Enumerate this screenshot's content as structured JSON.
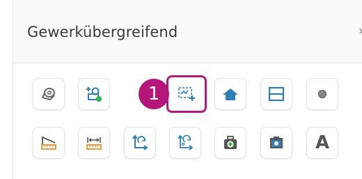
{
  "panel": {
    "title": "Gewerkübergreifend",
    "callout_number": "1"
  },
  "colors": {
    "accent": "#b5167a",
    "icon_blue": "#2f7fb6",
    "icon_orange": "#e8912a",
    "icon_green": "#2fb34a",
    "icon_gray": "#777777"
  },
  "tools": {
    "row1": [
      {
        "icon": "tape-roll-icon"
      },
      {
        "icon": "add-symbol-icon"
      },
      {
        "icon": "hidden-tool-icon"
      },
      {
        "icon": "add-area-frame-icon"
      },
      {
        "icon": "house-icon"
      },
      {
        "icon": "split-panel-icon"
      },
      {
        "icon": "dot-icon"
      }
    ],
    "row2": [
      {
        "icon": "slope-measure-icon"
      },
      {
        "icon": "width-measure-icon"
      },
      {
        "icon": "rotate-axis-icon"
      },
      {
        "icon": "rotate-angle-icon"
      },
      {
        "icon": "first-aid-kit-icon"
      },
      {
        "icon": "photo-frame-icon"
      },
      {
        "icon": "text-icon",
        "label": "A"
      }
    ]
  }
}
